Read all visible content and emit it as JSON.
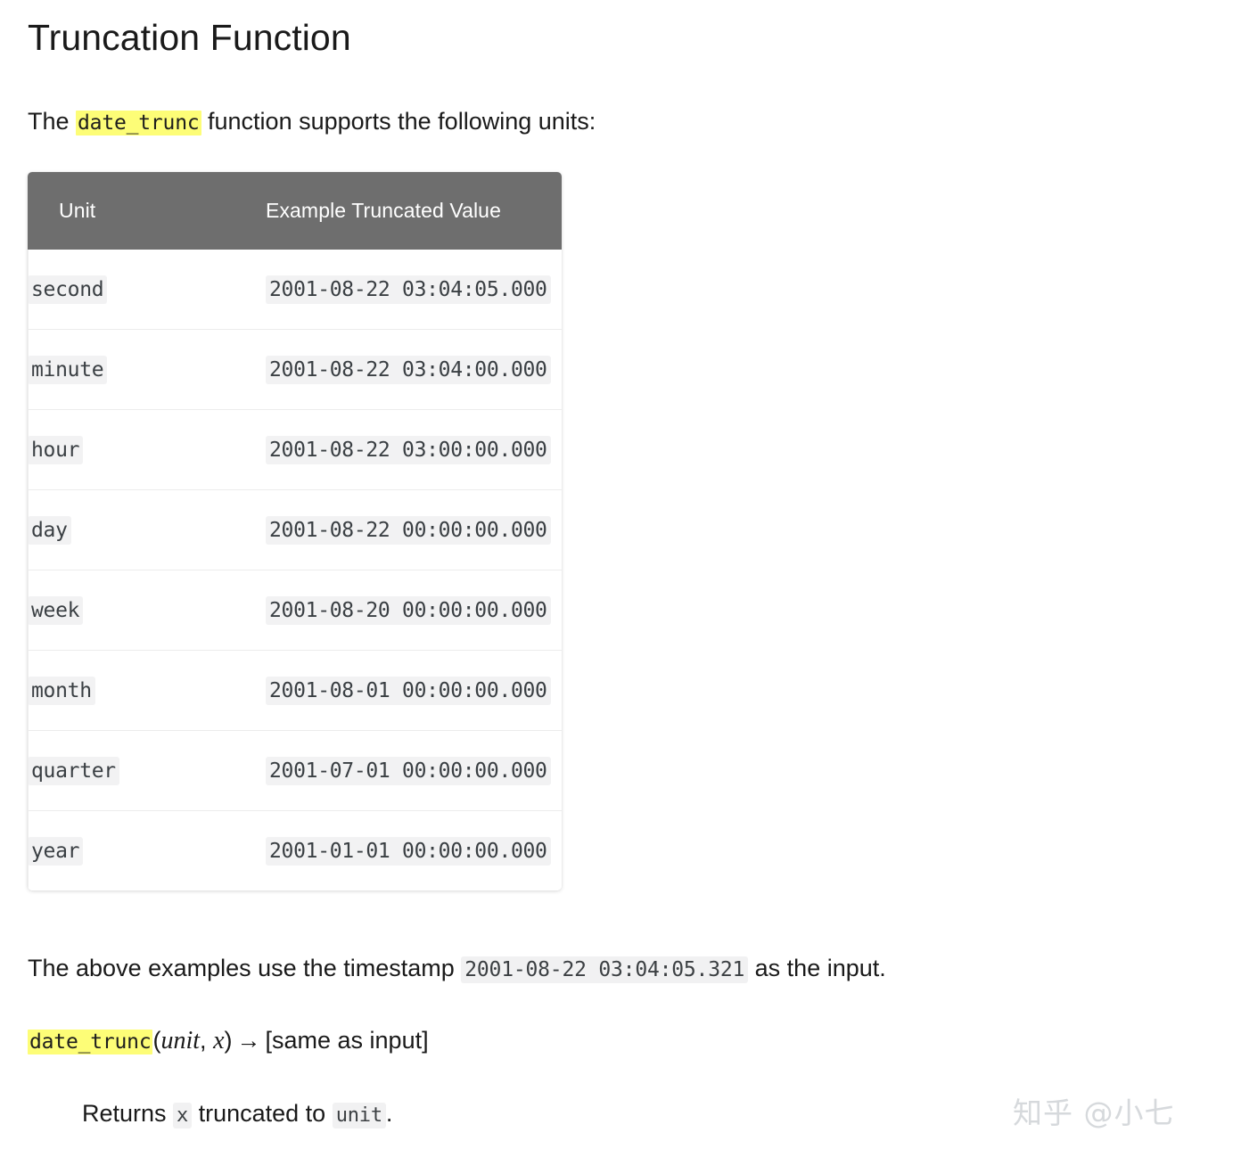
{
  "page": {
    "title": "Truncation Function",
    "background_color": "#ffffff"
  },
  "intro": {
    "before": "The ",
    "code": "date_trunc",
    "after": " function supports the following units:"
  },
  "table": {
    "headers": {
      "unit": "Unit",
      "value": "Example Truncated Value"
    },
    "header_bg": "#6e6e6e",
    "rows": [
      {
        "unit": "second",
        "value": "2001-08-22 03:04:05.000"
      },
      {
        "unit": "minute",
        "value": "2001-08-22 03:04:00.000"
      },
      {
        "unit": "hour",
        "value": "2001-08-22 03:00:00.000"
      },
      {
        "unit": "day",
        "value": "2001-08-22 00:00:00.000"
      },
      {
        "unit": "week",
        "value": "2001-08-20 00:00:00.000"
      },
      {
        "unit": "month",
        "value": "2001-08-01 00:00:00.000"
      },
      {
        "unit": "quarter",
        "value": "2001-07-01 00:00:00.000"
      },
      {
        "unit": "year",
        "value": "2001-01-01 00:00:00.000"
      }
    ]
  },
  "timestamp_note": {
    "before": "The above examples use the timestamp ",
    "code": "2001-08-22 03:04:05.321",
    "after": " as the input."
  },
  "signature": {
    "name": "date_trunc",
    "open_paren": "(",
    "param1": "unit",
    "comma": ", ",
    "param2": "x",
    "close_paren": ")",
    "arrow": "→",
    "return_type": "[same as input]"
  },
  "description": {
    "before": "Returns ",
    "code1": "x",
    "middle": " truncated to ",
    "code2": "unit",
    "after": "."
  },
  "watermark": {
    "text": "知乎 @小七",
    "color": "#d6d9dc"
  },
  "colors": {
    "highlight": "#fdfd77",
    "code_chip_bg": "#f2f2f3",
    "code_text": "#3a3f43",
    "row_divider": "#ececec"
  }
}
